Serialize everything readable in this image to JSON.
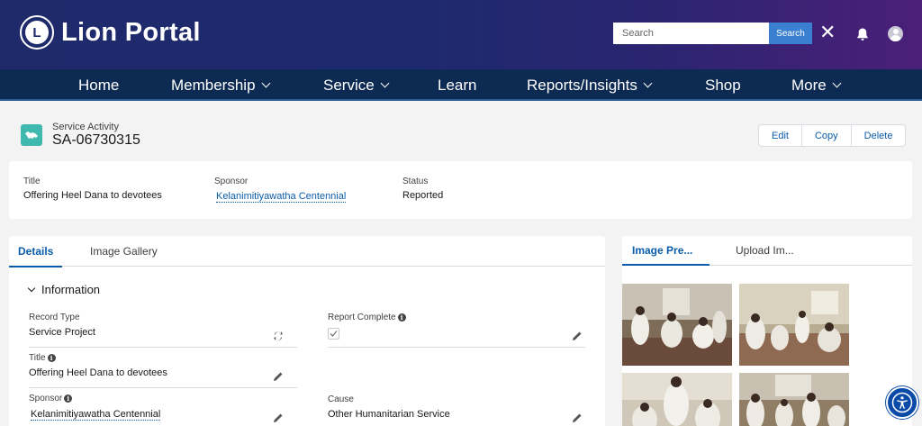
{
  "header": {
    "brand": "Lion Portal",
    "logo_letter": "L",
    "search_placeholder": "Search",
    "search_button": "Search",
    "close_glyph": "✕"
  },
  "nav": [
    {
      "label": "Home",
      "has_dropdown": false
    },
    {
      "label": "Membership",
      "has_dropdown": true
    },
    {
      "label": "Service",
      "has_dropdown": true
    },
    {
      "label": "Learn",
      "has_dropdown": false
    },
    {
      "label": "Reports/Insights",
      "has_dropdown": true
    },
    {
      "label": "Shop",
      "has_dropdown": false
    },
    {
      "label": "More",
      "has_dropdown": true
    }
  ],
  "record": {
    "type_label": "Service Activity",
    "name": "SA-06730315",
    "icon": "handshake-icon",
    "actions": [
      "Edit",
      "Copy",
      "Delete"
    ]
  },
  "highlights": {
    "title_label": "Title",
    "title_value": "Offering Heel Dana to devotees",
    "sponsor_label": "Sponsor",
    "sponsor_value": "Kelanimitiyawatha Centennial",
    "status_label": "Status",
    "status_value": "Reported"
  },
  "details": {
    "tabs": [
      "Details",
      "Image Gallery"
    ],
    "section_title": "Information",
    "fields": {
      "record_type_label": "Record Type",
      "record_type_value": "Service Project",
      "report_complete_label": "Report Complete",
      "report_complete_checked": true,
      "title_label": "Title",
      "title_value": "Offering Heel Dana to devotees",
      "sponsor_label": "Sponsor",
      "sponsor_value": "Kelanimitiyawatha Centennial",
      "cause_label": "Cause",
      "cause_value": "Other Humanitarian Service"
    }
  },
  "gallery": {
    "tabs": [
      "Image Pre...",
      "Upload Im..."
    ]
  },
  "colors": {
    "link": "#0b5cab",
    "nav_bg": "#0d2b52",
    "record_icon": "#3fb9ad",
    "search_button": "#3b7fd0"
  }
}
